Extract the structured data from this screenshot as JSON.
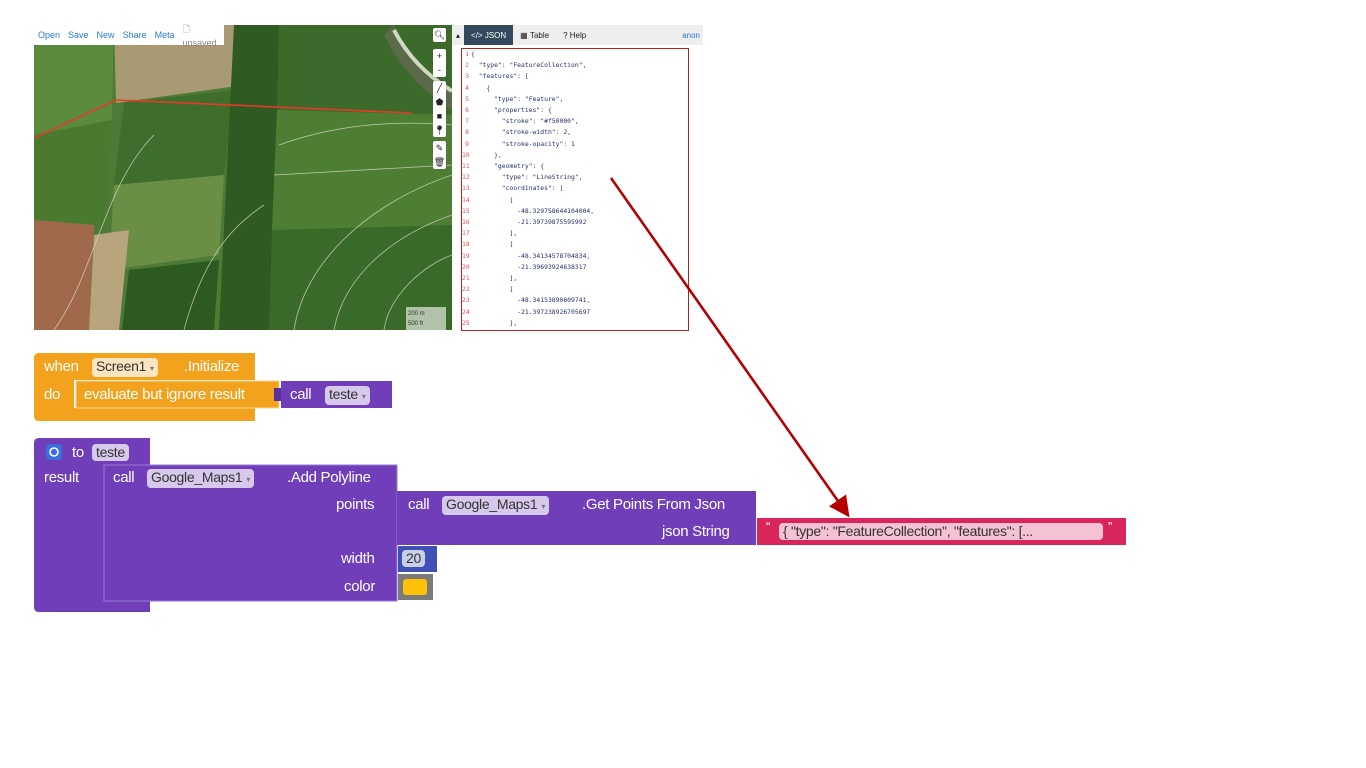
{
  "map": {
    "menu": [
      "Open",
      "Save",
      "New",
      "Share",
      "Meta"
    ],
    "unsaved": "unsaved",
    "scale_m": "200 m",
    "scale_ft": "500 ft",
    "zoom_in": "+",
    "zoom_out": "-"
  },
  "json_panel": {
    "tabs": [
      "JSON",
      "Table",
      "Help"
    ],
    "user": "anon",
    "lines": [
      "{",
      "  \"type\": \"FeatureCollection\",",
      "  \"features\": [",
      "    {",
      "      \"type\": \"Feature\",",
      "      \"properties\": {",
      "        \"stroke\": \"#f50000\",",
      "        \"stroke-width\": 2,",
      "        \"stroke-opacity\": 1",
      "      },",
      "      \"geometry\": {",
      "        \"type\": \"LineString\",",
      "        \"coordinates\": [",
      "          [",
      "            -48.329758644104004,",
      "            -21.39739875595992",
      "          ],",
      "          [",
      "            -48.34134578704834,",
      "            -21.39693924638317",
      "          ],",
      "          [",
      "            -48.34153890609741,",
      "            -21.397238926705697",
      "          ],"
    ]
  },
  "blocks": {
    "event": {
      "when": "when",
      "component": "Screen1",
      "event_name": ".Initialize",
      "do": "do",
      "evaluate": "evaluate but ignore result",
      "call": "call",
      "procedure": "teste"
    },
    "procedure": {
      "to": "to",
      "name": "teste",
      "result": "result",
      "call": "call",
      "component": "Google_Maps1",
      "method": ".Add Polyline",
      "points_label": "points",
      "inner_call": "call",
      "inner_component": "Google_Maps1",
      "inner_method": ".Get Points From Json",
      "json_label": "json String",
      "json_value": "{   \"type\": \"FeatureCollection\",   \"features\": [...",
      "width_label": "width",
      "width_value": "20",
      "color_label": "color"
    }
  },
  "colors": {
    "event_block": "#f3a21d",
    "procedure_block": "#6f3eb8",
    "text_block": "#d8265d",
    "math_block": "#3f51b5",
    "color_swatch": "#ffc107",
    "arrow": "#b40000",
    "polyline": "#e53a2a"
  }
}
